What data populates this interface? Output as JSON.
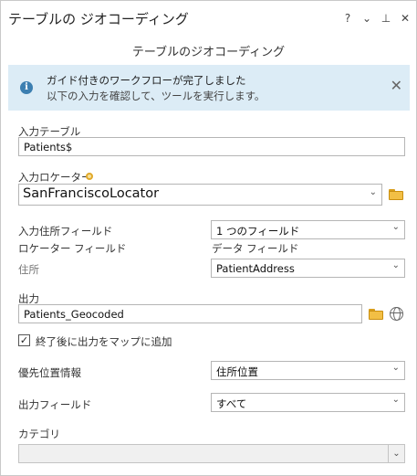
{
  "window": {
    "title": "テーブルの ジオコーディング",
    "help_label": "?",
    "menu_label": "⌄",
    "pin_label": "⊥",
    "close_label": "✕"
  },
  "tool": {
    "title": "テーブルのジオコーディング"
  },
  "banner": {
    "line1": "ガイド付きのワークフローが完了しました",
    "line2": "以下の入力を確認して、ツールを実行します。",
    "info_icon": "i",
    "close_label": "✕"
  },
  "params": {
    "input_table": {
      "label": "入力テーブル",
      "value": "Patients$"
    },
    "input_locator": {
      "label": "入力ロケーター",
      "value": "SanFranciscoLocator"
    },
    "input_address_fields": {
      "label": "入力住所フィールド",
      "value": "1 つのフィールド"
    },
    "locator_field_header": "ロケーター フィールド",
    "data_field_header": "データ フィールド",
    "address_row": {
      "label": "住所",
      "value": "PatientAddress"
    },
    "output": {
      "label": "出力",
      "value": "Patients_Geocoded"
    },
    "add_to_map": {
      "label": "終了後に出力をマップに追加",
      "checked": true,
      "check_glyph": "✓"
    },
    "preferred_location": {
      "label": "優先位置情報",
      "value": "住所位置"
    },
    "output_fields": {
      "label": "出力フィールド",
      "value": "すべて"
    },
    "category": {
      "label": "カテゴリ",
      "value": ""
    }
  },
  "icons": {
    "chevron": "⌄",
    "folder": "folder-icon",
    "globe": "globe-icon",
    "locator_status": "gear-icon"
  },
  "colors": {
    "banner_bg": "#dcecf6",
    "info_icon": "#3c7fb1",
    "folder": "#f2bf45"
  }
}
